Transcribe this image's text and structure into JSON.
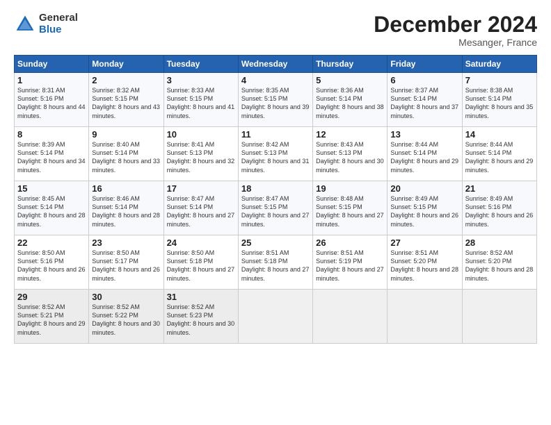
{
  "header": {
    "logo_general": "General",
    "logo_blue": "Blue",
    "month": "December 2024",
    "location": "Mesanger, France"
  },
  "days_of_week": [
    "Sunday",
    "Monday",
    "Tuesday",
    "Wednesday",
    "Thursday",
    "Friday",
    "Saturday"
  ],
  "weeks": [
    [
      {
        "day": "1",
        "sunrise": "8:31 AM",
        "sunset": "5:16 PM",
        "daylight": "8 hours and 44 minutes."
      },
      {
        "day": "2",
        "sunrise": "8:32 AM",
        "sunset": "5:15 PM",
        "daylight": "8 hours and 43 minutes."
      },
      {
        "day": "3",
        "sunrise": "8:33 AM",
        "sunset": "5:15 PM",
        "daylight": "8 hours and 41 minutes."
      },
      {
        "day": "4",
        "sunrise": "8:35 AM",
        "sunset": "5:15 PM",
        "daylight": "8 hours and 39 minutes."
      },
      {
        "day": "5",
        "sunrise": "8:36 AM",
        "sunset": "5:14 PM",
        "daylight": "8 hours and 38 minutes."
      },
      {
        "day": "6",
        "sunrise": "8:37 AM",
        "sunset": "5:14 PM",
        "daylight": "8 hours and 37 minutes."
      },
      {
        "day": "7",
        "sunrise": "8:38 AM",
        "sunset": "5:14 PM",
        "daylight": "8 hours and 35 minutes."
      }
    ],
    [
      {
        "day": "8",
        "sunrise": "8:39 AM",
        "sunset": "5:14 PM",
        "daylight": "8 hours and 34 minutes."
      },
      {
        "day": "9",
        "sunrise": "8:40 AM",
        "sunset": "5:14 PM",
        "daylight": "8 hours and 33 minutes."
      },
      {
        "day": "10",
        "sunrise": "8:41 AM",
        "sunset": "5:13 PM",
        "daylight": "8 hours and 32 minutes."
      },
      {
        "day": "11",
        "sunrise": "8:42 AM",
        "sunset": "5:13 PM",
        "daylight": "8 hours and 31 minutes."
      },
      {
        "day": "12",
        "sunrise": "8:43 AM",
        "sunset": "5:13 PM",
        "daylight": "8 hours and 30 minutes."
      },
      {
        "day": "13",
        "sunrise": "8:44 AM",
        "sunset": "5:14 PM",
        "daylight": "8 hours and 29 minutes."
      },
      {
        "day": "14",
        "sunrise": "8:44 AM",
        "sunset": "5:14 PM",
        "daylight": "8 hours and 29 minutes."
      }
    ],
    [
      {
        "day": "15",
        "sunrise": "8:45 AM",
        "sunset": "5:14 PM",
        "daylight": "8 hours and 28 minutes."
      },
      {
        "day": "16",
        "sunrise": "8:46 AM",
        "sunset": "5:14 PM",
        "daylight": "8 hours and 28 minutes."
      },
      {
        "day": "17",
        "sunrise": "8:47 AM",
        "sunset": "5:14 PM",
        "daylight": "8 hours and 27 minutes."
      },
      {
        "day": "18",
        "sunrise": "8:47 AM",
        "sunset": "5:15 PM",
        "daylight": "8 hours and 27 minutes."
      },
      {
        "day": "19",
        "sunrise": "8:48 AM",
        "sunset": "5:15 PM",
        "daylight": "8 hours and 27 minutes."
      },
      {
        "day": "20",
        "sunrise": "8:49 AM",
        "sunset": "5:15 PM",
        "daylight": "8 hours and 26 minutes."
      },
      {
        "day": "21",
        "sunrise": "8:49 AM",
        "sunset": "5:16 PM",
        "daylight": "8 hours and 26 minutes."
      }
    ],
    [
      {
        "day": "22",
        "sunrise": "8:50 AM",
        "sunset": "5:16 PM",
        "daylight": "8 hours and 26 minutes."
      },
      {
        "day": "23",
        "sunrise": "8:50 AM",
        "sunset": "5:17 PM",
        "daylight": "8 hours and 26 minutes."
      },
      {
        "day": "24",
        "sunrise": "8:50 AM",
        "sunset": "5:18 PM",
        "daylight": "8 hours and 27 minutes."
      },
      {
        "day": "25",
        "sunrise": "8:51 AM",
        "sunset": "5:18 PM",
        "daylight": "8 hours and 27 minutes."
      },
      {
        "day": "26",
        "sunrise": "8:51 AM",
        "sunset": "5:19 PM",
        "daylight": "8 hours and 27 minutes."
      },
      {
        "day": "27",
        "sunrise": "8:51 AM",
        "sunset": "5:20 PM",
        "daylight": "8 hours and 28 minutes."
      },
      {
        "day": "28",
        "sunrise": "8:52 AM",
        "sunset": "5:20 PM",
        "daylight": "8 hours and 28 minutes."
      }
    ],
    [
      {
        "day": "29",
        "sunrise": "8:52 AM",
        "sunset": "5:21 PM",
        "daylight": "8 hours and 29 minutes."
      },
      {
        "day": "30",
        "sunrise": "8:52 AM",
        "sunset": "5:22 PM",
        "daylight": "8 hours and 30 minutes."
      },
      {
        "day": "31",
        "sunrise": "8:52 AM",
        "sunset": "5:23 PM",
        "daylight": "8 hours and 30 minutes."
      },
      null,
      null,
      null,
      null
    ]
  ]
}
